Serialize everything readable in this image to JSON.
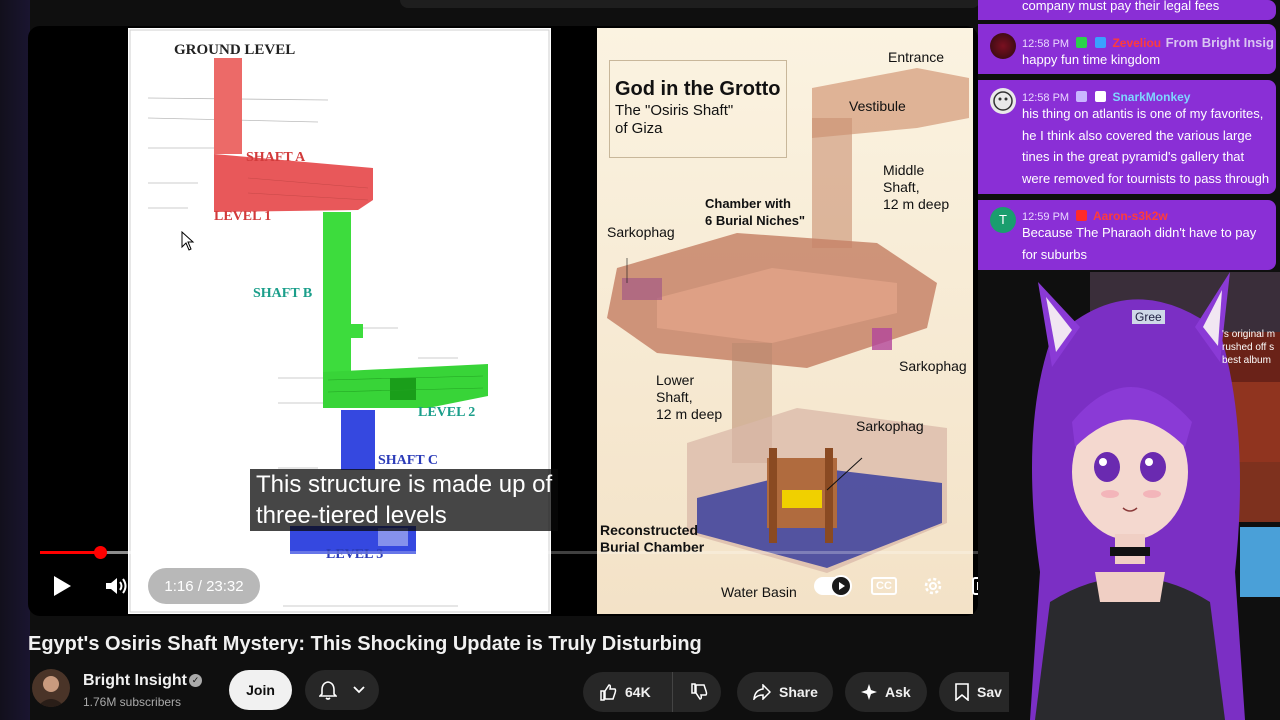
{
  "video": {
    "left_diagram": {
      "ground_level": "GROUND LEVEL",
      "shaft_a": "SHAFT A",
      "level_1": "LEVEL 1",
      "shaft_b": "SHAFT B",
      "level_2": "LEVEL 2",
      "shaft_c": "SHAFT C",
      "level_3": "LEVEL 3"
    },
    "right_diagram": {
      "title": "God in the Grotto",
      "subtitle_line1": "The \"Osiris Shaft\"",
      "subtitle_line2": "of Giza",
      "entrance": "Entrance",
      "vestibule": "Vestibule",
      "middle_shaft_1": "Middle",
      "middle_shaft_2": "Shaft,",
      "middle_shaft_3": "12 m deep",
      "chamber_1": "Chamber with",
      "chamber_2": "6 Burial Niches\"",
      "sarkophag_1": "Sarkophag",
      "sarkophag_2": "Sarkophag",
      "sarkophag_3": "Sarkophag",
      "lower_shaft_1": "Lower",
      "lower_shaft_2": "Shaft,",
      "lower_shaft_3": "12 m deep",
      "reconstructed_1": "Reconstructed",
      "reconstructed_2": "Burial Chamber",
      "water_basin": "Water Basin"
    },
    "captions": {
      "line1": "This structure is made up of",
      "line2": "three-tiered levels"
    },
    "player": {
      "time": "1:16 / 23:32",
      "progress_played": 0.06,
      "progress_loaded": 0.14,
      "cc_label": "CC"
    }
  },
  "chat": {
    "messages": [
      {
        "time": "",
        "user": "",
        "text": "company must pay their legal fees"
      },
      {
        "time": "12:58 PM",
        "user": "Zeveliou",
        "text": "happy fun time kingdom",
        "user_color": "#ff3b3b"
      },
      {
        "time": "12:58 PM",
        "user": "SnarkMonkey",
        "text_lines": [
          "his thing on atlantis is one of my favorites,",
          "he I think also covered the various large",
          "tines in the great pyramid's gallery that",
          "were removed for tournists to pass through"
        ],
        "user_color": "#7fd6ff"
      },
      {
        "time": "12:59 PM",
        "user": "Aaron-s3k2w",
        "text_lines": [
          "Because The Pharaoh didn't have to pay",
          "for suburbs"
        ],
        "user_color": "#ff3b3b",
        "avatar_letter": "T"
      }
    ],
    "overlay_text": "From Bright Insig"
  },
  "vtuber_panel": {
    "side_text_1": "'s original m",
    "side_text_2": "rushed off s",
    "side_text_3": "best album",
    "side_tag": "Gree"
  },
  "below": {
    "title": "Egypt's Osiris Shaft Mystery: This Shocking Update is Truly Disturbing",
    "channel_name": "Bright Insight",
    "subscribers": "1.76M subscribers",
    "join_label": "Join",
    "like_count": "64K",
    "share_label": "Share",
    "ask_label": "Ask",
    "save_label": "Sav"
  },
  "colors": {
    "accent_red": "#ff0000",
    "chat_purple": "#8a2fd6",
    "shaft_a": "#e8585a",
    "shaft_b": "#3ddc3d",
    "shaft_c": "#3548e0"
  }
}
